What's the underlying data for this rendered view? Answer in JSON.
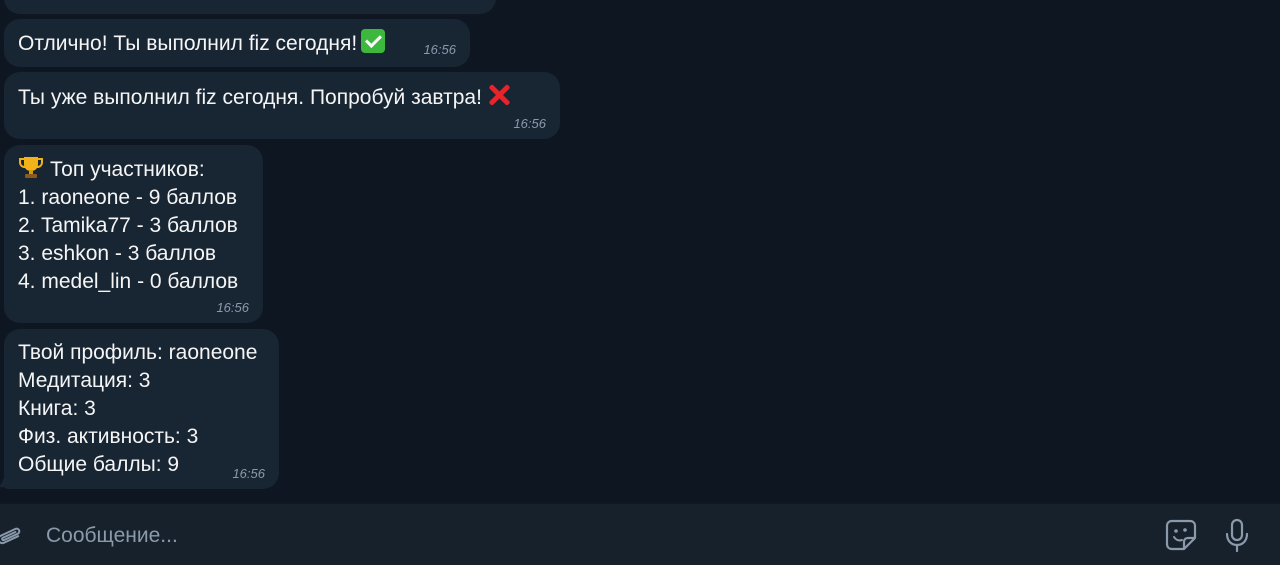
{
  "messages": [
    {
      "id": "msg-fiz-done",
      "text": "Отлично! Ты выполнил fiz сегодня!",
      "emoji": "check-mark-button-icon",
      "time": "16:56"
    },
    {
      "id": "msg-fiz-already",
      "text": "Ты уже выполнил fiz сегодня. Попробуй завтра!",
      "emoji": "cross-mark-icon",
      "time": "16:56"
    },
    {
      "id": "msg-leaderboard",
      "title": "Топ участников:",
      "title_icon": "trophy-icon",
      "lines": [
        "1. raoneone - 9 баллов",
        "2. Tamika77 - 3 баллов",
        "3. eshkon - 3 баллов",
        "4. medel_lin - 0 баллов"
      ],
      "time": "16:56"
    },
    {
      "id": "msg-profile",
      "lines": [
        "Твой профиль: raoneone",
        "Медитация: 3",
        "Книга: 3",
        "Физ. активность: 3",
        "Общие баллы: 9"
      ],
      "time": "16:56"
    }
  ],
  "composer": {
    "placeholder": "Сообщение...",
    "attach_icon": "paperclip-icon",
    "sticker_icon": "sticker-icon",
    "mic_icon": "microphone-icon"
  },
  "colors": {
    "chat_background": "#0e1621",
    "bubble": "#182533",
    "composer_background": "#17212b",
    "text": "#f5f5f5",
    "timestamp": "#8a9aab",
    "check_green": "#3cb93c",
    "cross_red": "#e8232a"
  }
}
